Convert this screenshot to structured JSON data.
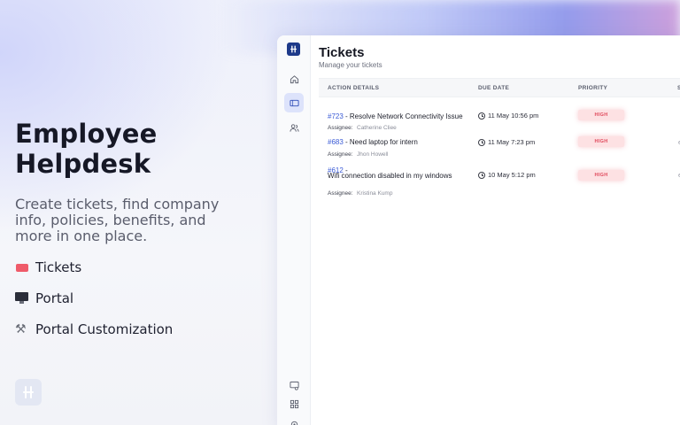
{
  "hero": {
    "title": "Employee Helpdesk",
    "description": "Create tickets, find company info, policies, benefits, and more in one place.",
    "features": [
      {
        "label": "Tickets",
        "icon": "ticket-icon"
      },
      {
        "label": "Portal",
        "icon": "monitor-icon"
      },
      {
        "label": "Portal Customization",
        "icon": "tools-icon"
      }
    ]
  },
  "app": {
    "title": "Tickets",
    "subtitle": "Manage your tickets",
    "columns": [
      "ACTION DETAILS",
      "DUE DATE",
      "PRIORITY",
      "S"
    ],
    "assignee_label": "Assignee:",
    "tickets": [
      {
        "id": "#723",
        "sep": " - ",
        "title": "Resolve Network Connectivity Issue",
        "assignee": "Catherine Cliee",
        "due": "11 May 10:56 pm",
        "priority": "HIGH",
        "status": "",
        "id_line_title": "Resolve Network Connectivity Issue"
      },
      {
        "id": "#683",
        "sep": " - ",
        "title": "Need laptop for intern",
        "assignee": "Jhon Howell",
        "due": "11 May 7:23 pm",
        "priority": "HIGH",
        "status": "e"
      },
      {
        "id": "#612",
        "sep": " - ",
        "title": "Wifi connection disabled in my windows",
        "assignee": "Kristina Kump",
        "due": "10 May 5:12 pm",
        "priority": "HIGH",
        "status": "e"
      }
    ]
  },
  "colors": {
    "accent": "#3b5bd6",
    "logo": "#1e3a8a",
    "priority_high_bg": "#fde1e3",
    "priority_high_text": "#e0485b"
  }
}
